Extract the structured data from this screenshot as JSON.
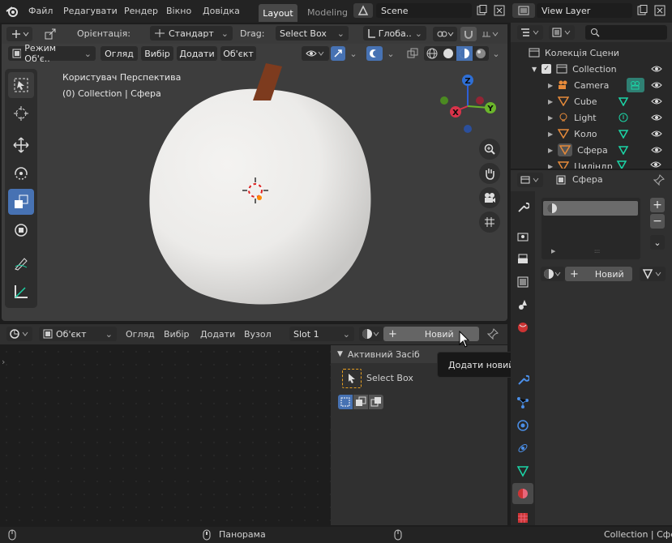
{
  "topbar": {
    "menus": [
      "Файл",
      "Редагувати",
      "Рендер",
      "Вікно",
      "Довідка"
    ],
    "workspace_tabs": [
      "Layout",
      "Modeling"
    ],
    "scene": "Scene",
    "view_layer": "View Layer"
  },
  "viewport": {
    "orientation_label": "Орієнтація:",
    "orientation_value": "Стандарт",
    "drag_label": "Drag:",
    "drag_value": "Select Box",
    "transform_value": "Глоба..",
    "mode": "Режим Об'є..",
    "menus": [
      "Огляд",
      "Вибір",
      "Додати",
      "Об'єкт"
    ],
    "overlay_line1": "Користувач Перспектива",
    "overlay_line2": "(0) Collection | Сфера",
    "gizmo": {
      "x": "X",
      "y": "Y",
      "z": "Z"
    }
  },
  "shader_editor": {
    "object_dd": "Об'єкт",
    "menus": [
      "Огляд",
      "Вибір",
      "Додати",
      "Вузол"
    ],
    "slot": "Slot 1",
    "new_button": "Новий"
  },
  "tool_panel": {
    "title": "Активний Засіб",
    "tool_name": "Select Box"
  },
  "tooltip": "Додати новий матеріал.",
  "outliner": {
    "title": "Колекція Сцени",
    "collection": "Collection",
    "items": [
      "Camera",
      "Cube",
      "Light",
      "Коло",
      "Сфера",
      "Циліндр"
    ]
  },
  "properties": {
    "object_name": "Сфера",
    "new_button": "Новий"
  },
  "statusbar": {
    "middle": "Панорама",
    "right": "Collection | Сфе"
  },
  "colors": {
    "accent": "#4772b3",
    "mesh_green": "#1bd6a7",
    "sphere": "#f1f0ee",
    "tooltip_bg": "#181818"
  }
}
